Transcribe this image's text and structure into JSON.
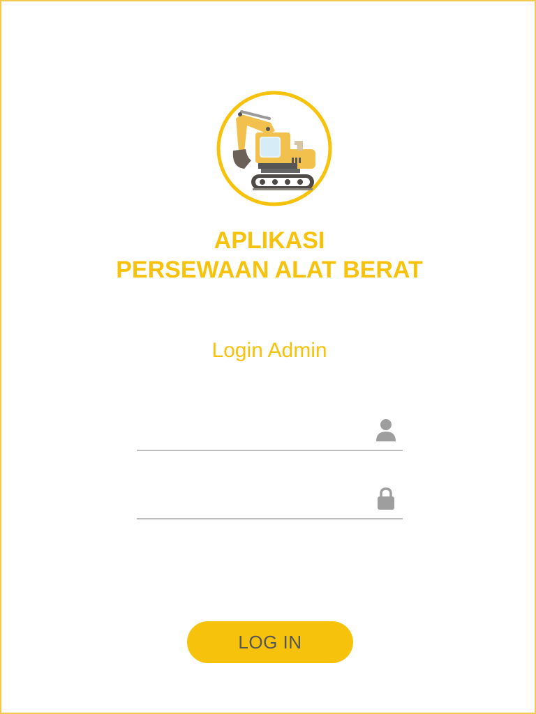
{
  "header": {
    "title_line1": "APLIKASI",
    "title_line2": "PERSEWAAN ALAT BERAT",
    "subtitle": "Login Admin"
  },
  "form": {
    "username": {
      "value": "",
      "placeholder": "",
      "icon": "user-icon"
    },
    "password": {
      "value": "",
      "placeholder": "",
      "icon": "lock-icon"
    },
    "submit_label": "LOG IN"
  },
  "colors": {
    "accent": "#f6c20b",
    "border": "#f2c94c",
    "input_underline": "#bdbdbd",
    "icon_gray": "#9e9e9e",
    "button_text": "#555555"
  },
  "logo": {
    "icon": "excavator-icon"
  }
}
